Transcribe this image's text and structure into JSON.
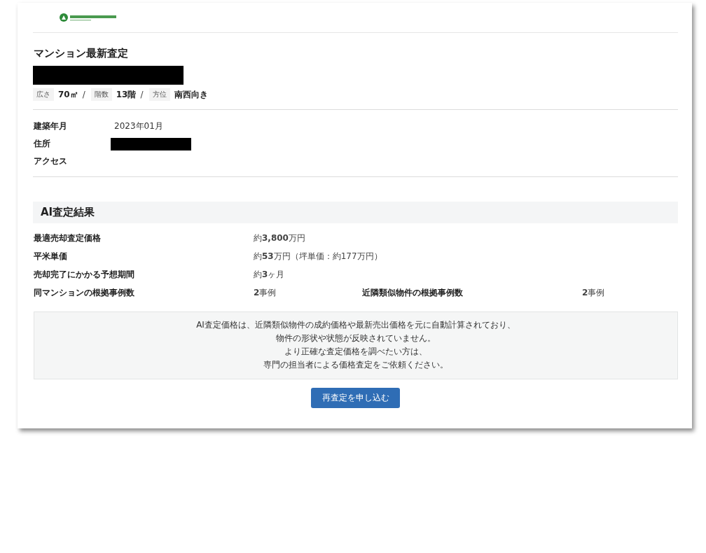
{
  "page": {
    "title": "マンション最新査定",
    "name_redacted": true
  },
  "specs": [
    {
      "label": "広さ",
      "value": "70㎡",
      "separator": "/"
    },
    {
      "label": "階数",
      "value": "13階",
      "separator": "/"
    },
    {
      "label": "方位",
      "value": "南西向き"
    }
  ],
  "details": [
    {
      "label": "建築年月",
      "value": "2023年01月",
      "redacted": false
    },
    {
      "label": "住所",
      "redacted": true
    },
    {
      "label": "アクセス",
      "redacted": false
    }
  ],
  "result": {
    "title": "AI査定結果",
    "rows": [
      {
        "label": "最適売却査定価格",
        "value": "約**3,800**万円"
      },
      {
        "label": "平米単価",
        "value": "約**53**万円（坪単価：約177万円）"
      },
      {
        "label": "売却完了にかかる予想期間",
        "value": "約**3**ヶ月"
      },
      {
        "label": "同マンションの根拠事例数",
        "value": "**2**事例",
        "extra_label": "近隣類似物件の根拠事例数",
        "extra_value": "**2**事例"
      }
    ]
  },
  "notice": {
    "lines": [
      "AI査定価格は、近隣類似物件の成約価格や最新売出価格を元に自動計算されており、",
      "物件の形状や状態が反映されていません。",
      "より正確な査定価格を調べたい方は、",
      "専門の担当者による価格査定をご依頼ください。"
    ]
  },
  "button": {
    "label": "再査定を申し込む"
  }
}
